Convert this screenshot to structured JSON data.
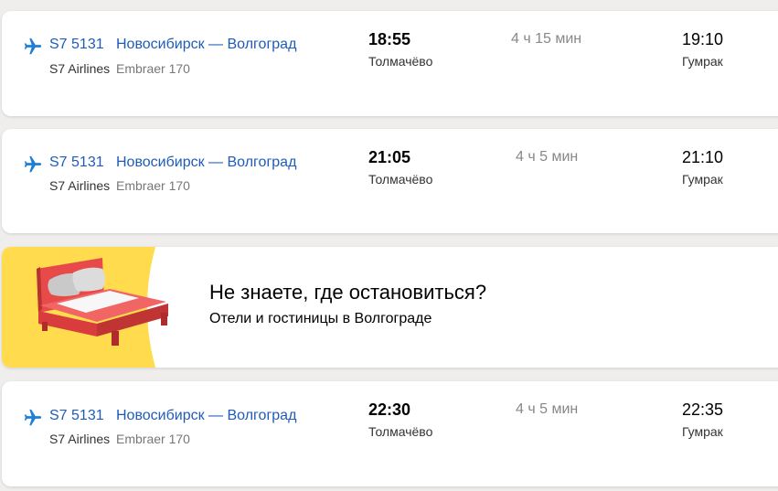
{
  "flights": [
    {
      "flight_number": "S7 5131",
      "route": "Новосибирск — Волгоград",
      "airline": "S7 Airlines",
      "aircraft": "Embraer 170",
      "departure_time": "18:55",
      "departure_airport": "Толмачёво",
      "duration": "4 ч 15 мин",
      "arrival_time": "19:10",
      "arrival_airport": "Гумрак"
    },
    {
      "flight_number": "S7 5131",
      "route": "Новосибирск — Волгоград",
      "airline": "S7 Airlines",
      "aircraft": "Embraer 170",
      "departure_time": "21:05",
      "departure_airport": "Толмачёво",
      "duration": "4 ч 5 мин",
      "arrival_time": "21:10",
      "arrival_airport": "Гумрак"
    },
    {
      "flight_number": "S7 5131",
      "route": "Новосибирск — Волгоград",
      "airline": "S7 Airlines",
      "aircraft": "Embraer 170",
      "departure_time": "22:30",
      "departure_airport": "Толмачёво",
      "duration": "4 ч 5 мин",
      "arrival_time": "22:35",
      "arrival_airport": "Гумрак"
    }
  ],
  "promo": {
    "title": "Не знаете, где остановиться?",
    "subtitle": "Отели и гостиницы в Волгограде",
    "icon": "bed-icon"
  },
  "icons": {
    "flight": "plane-icon"
  },
  "colors": {
    "link": "#1f5cb8",
    "promo_yellow": "#ffdb4d",
    "bed_red": "#e84a4a",
    "background": "#efeeec"
  }
}
